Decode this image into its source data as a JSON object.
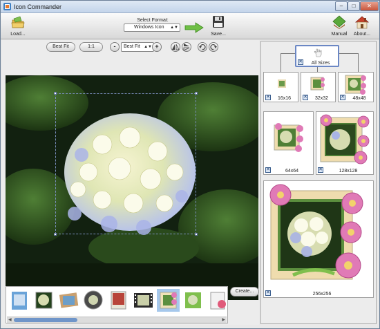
{
  "window": {
    "title": "Icon Commander",
    "minimize": "–",
    "maximize": "□",
    "close": "✕"
  },
  "toolbar": {
    "load_label": "Load...",
    "format_label": "Select Format:",
    "format_value": "Windows Icon",
    "save_label": "Save...",
    "manual_label": "Manual",
    "about_label": "About..."
  },
  "controls": {
    "best_fit": "Best Fit",
    "one_to_one": "1:1",
    "zoom_out": "-",
    "zoom_value": "Best Fit",
    "zoom_in": "+"
  },
  "create_label": "Create...",
  "sizes": {
    "all_label": "All Sizes",
    "items": [
      "16x16",
      "32x32",
      "48x48",
      "64x64",
      "128x128",
      "256x256"
    ]
  },
  "colors": {
    "accent": "#6b87c4",
    "arrow_green": "#5aa83a",
    "selection": "#a6c8ec"
  }
}
